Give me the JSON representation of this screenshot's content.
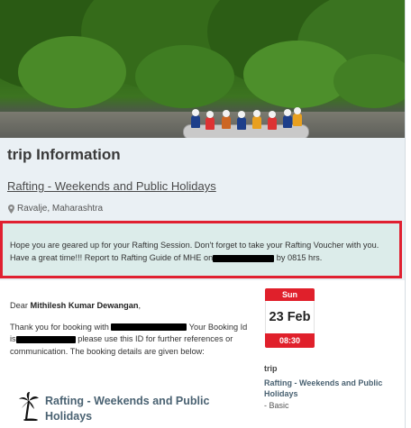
{
  "page": {
    "title": "trip Information",
    "trip_link": "Rafting - Weekends and Public Holidays",
    "location": "Ravalje, Maharashtra"
  },
  "notice": {
    "line1": "Hope you are geared up for your Rafting Session. Don't forget to take your Rafting Voucher with you.",
    "line2_pre": "Have a great time!!! Report to Rafting Guide of MHE on",
    "line2_post": "by 0815 hrs."
  },
  "letter": {
    "greeting_pre": "Dear",
    "customer_name": "Mithilesh Kumar Dewangan",
    "greeting_post": ",",
    "thanks_pre": "Thank you for booking with",
    "thanks_mid": "Your Booking Id is",
    "thanks_post": "please use this ID for further references or communication. The booking details are given below:"
  },
  "product": {
    "icon": "palm-tree-icon",
    "name": "Rafting - Weekends and Public Holidays"
  },
  "schedule": {
    "day": "Sun",
    "date": "23 Feb",
    "time": "08:30"
  },
  "sidebar": {
    "label": "trip",
    "product_name": "Rafting - Weekends and Public Holidays",
    "variant": "- Basic"
  },
  "colors": {
    "accent_red": "#e0202b",
    "notice_bg": "#dcecea",
    "product_text": "#4a6272"
  }
}
